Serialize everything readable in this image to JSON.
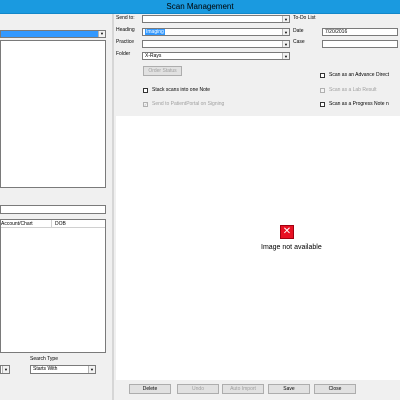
{
  "window": {
    "title": "Scan Management"
  },
  "form": {
    "send_to_label": "Send to:",
    "todo_label": "To-Do List",
    "heading_label": "Heading",
    "heading_value": "Imaging",
    "date_label": "Date",
    "date_value": "7/20/2016",
    "practice_label": "Practice",
    "case_label": "Case",
    "folder_label": "Folder",
    "folder_value": "X-Rays",
    "order_status_label": "Order Status",
    "stack_label": "Stack scans into one Note",
    "portal_label": "Send to PatientPortal on Signing",
    "advance_label": "Scan as an Advance Direct",
    "lab_label": "Scan as a Lab Result",
    "progress_label": "Scan as a Progress Note n"
  },
  "preview": {
    "unavailable_text": "Image not available"
  },
  "left": {
    "columns": [
      "Account/Chart",
      "DOB"
    ],
    "search_type_label": "Search Type",
    "search_type_value": "Starts With"
  },
  "buttons": {
    "delete": "Delete",
    "undo": "Undo",
    "auto_import": "Auto Import",
    "save": "Save",
    "close": "Close"
  },
  "colors": {
    "titlebar": "#1a9ae0",
    "selection": "#3399ff",
    "error_icon": "#e81123"
  }
}
